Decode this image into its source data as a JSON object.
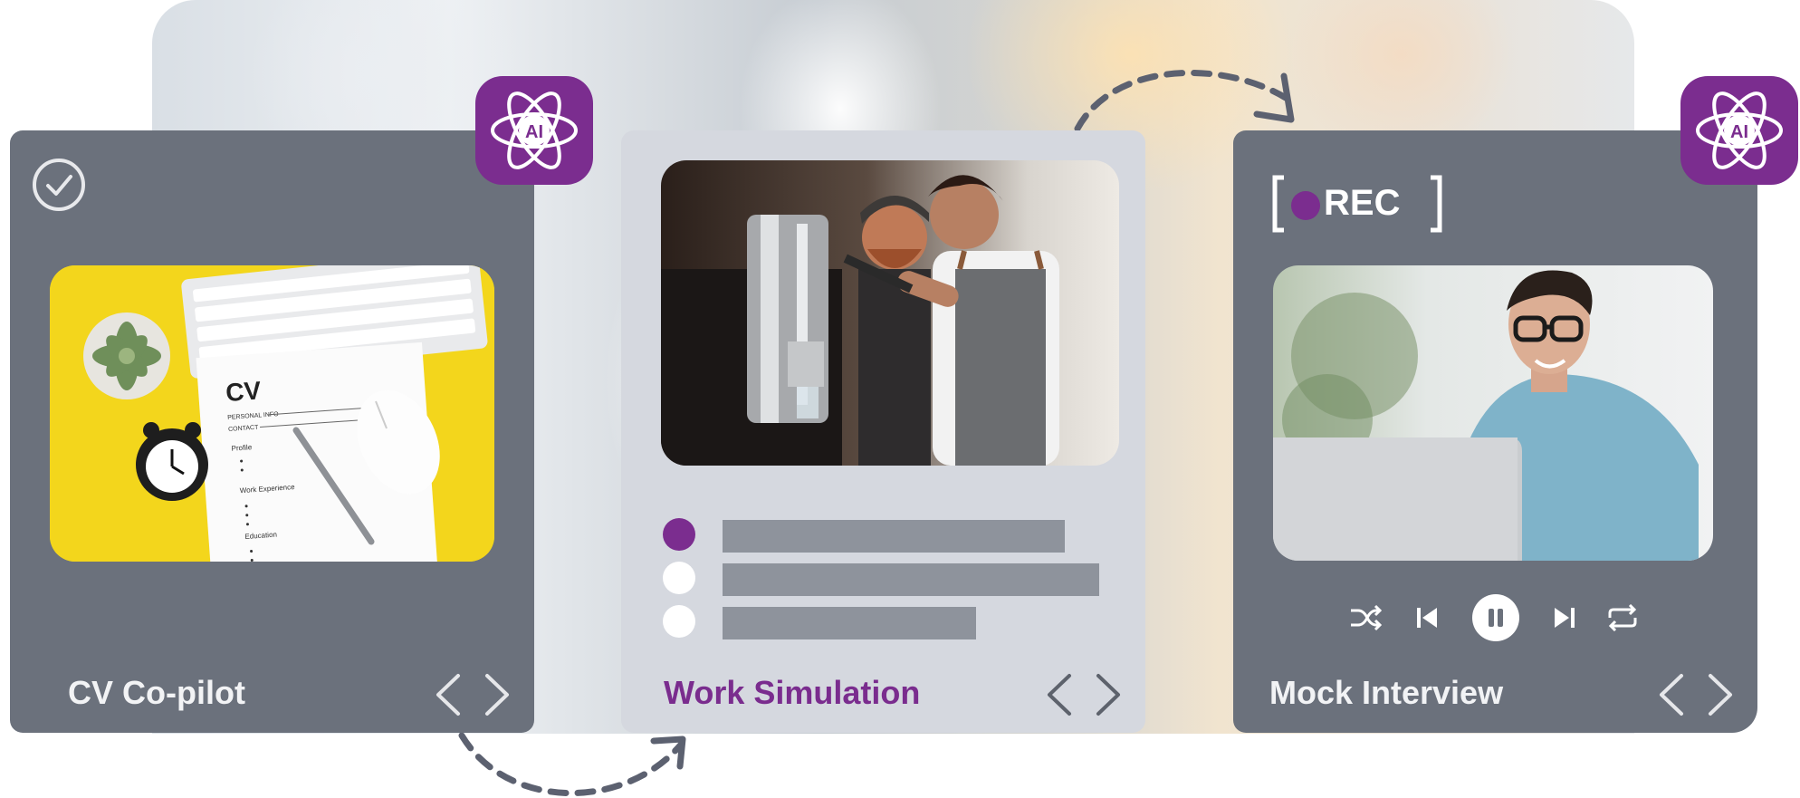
{
  "cards": {
    "cv": {
      "title": "CV Co-pilot"
    },
    "work_simulation": {
      "title": "Work Simulation"
    },
    "mock_interview": {
      "title": "Mock Interview",
      "rec_label": "REC"
    }
  },
  "ai_badge_text": "AI",
  "cv_document": {
    "heading": "CV",
    "lines": [
      "PERSONAL INFO",
      "CONTACT",
      "Profile",
      "Work Experience",
      "Education"
    ]
  },
  "colors": {
    "accent_purple": "#7b2d8f",
    "card_dark": "#6b717c",
    "card_light": "#d5d8df",
    "option_bar": "#8e939c",
    "arrow_gray": "#5c6170"
  },
  "work_simulation_options": [
    {
      "state": "selected"
    },
    {
      "state": "unselected"
    },
    {
      "state": "unselected"
    }
  ],
  "icons": {
    "check": "check-circle-icon",
    "ai": "ai-atom-icon",
    "prev": "chevron-left-icon",
    "next": "chevron-right-icon",
    "shuffle": "shuffle-icon",
    "skip_back": "skip-back-icon",
    "pause": "pause-icon",
    "skip_forward": "skip-forward-icon",
    "repeat": "repeat-icon"
  }
}
